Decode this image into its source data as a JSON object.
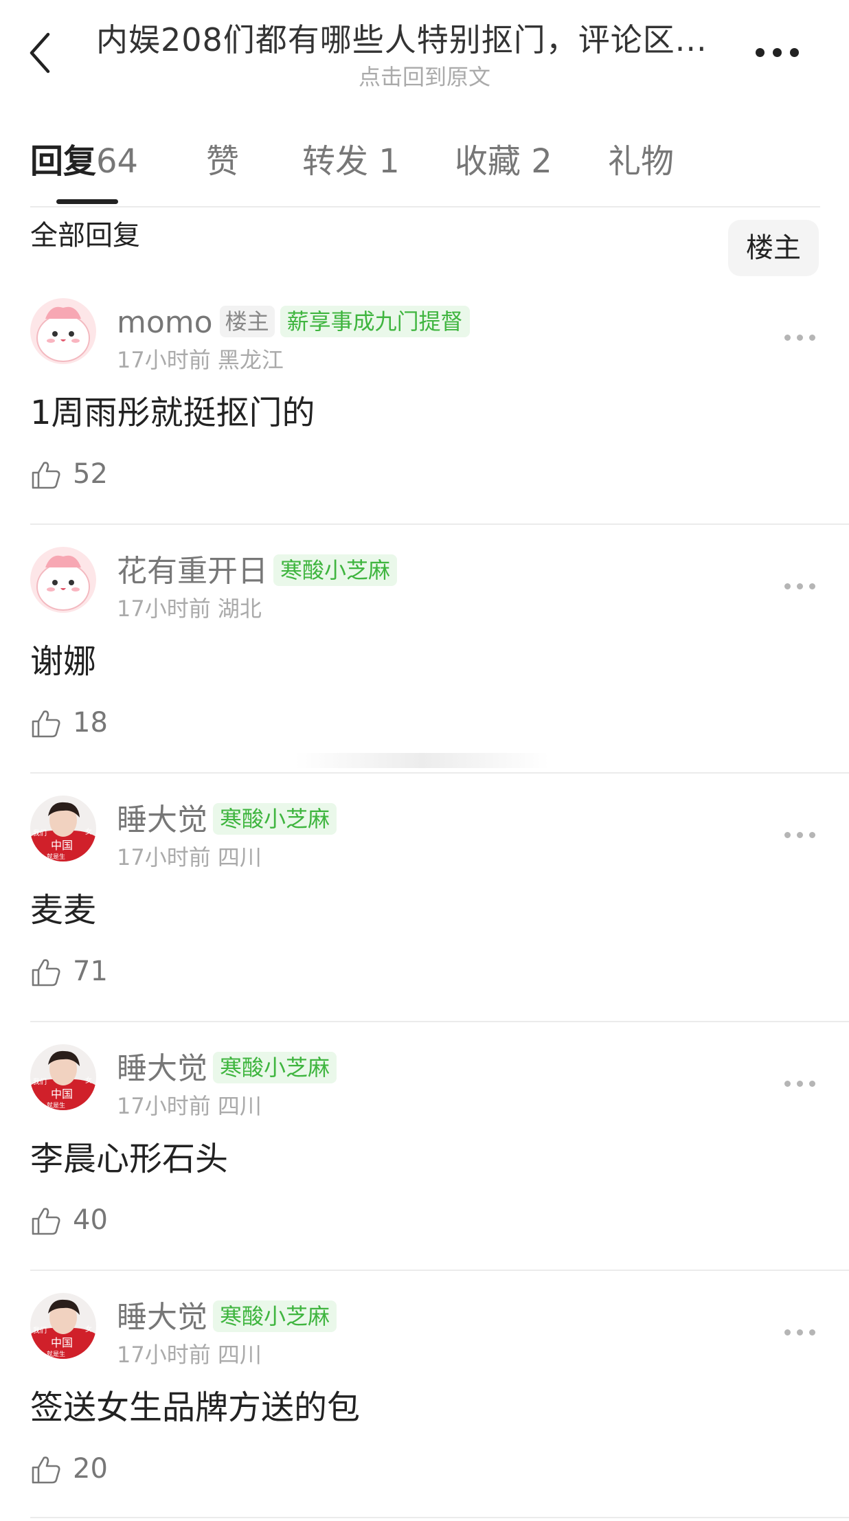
{
  "header": {
    "title": "内娱208们都有哪些人特别抠门，评论区...",
    "subtitle": "点击回到原文"
  },
  "tabs": [
    {
      "label": "回复",
      "count": "64"
    },
    {
      "label": "赞",
      "count": ""
    },
    {
      "label": "转发",
      "count": "1"
    },
    {
      "label": "收藏",
      "count": "2"
    },
    {
      "label": "礼物",
      "count": ""
    }
  ],
  "section": {
    "title": "全部回复",
    "owner_filter": "楼主"
  },
  "comments": [
    {
      "user": "momo",
      "owner_tag": "楼主",
      "level": "薪享事成九门提督",
      "time_location": "17小时前 黑龙江",
      "text": "1周雨彤就挺抠门的",
      "likes": "52",
      "avatar": "pink-blob-avatar"
    },
    {
      "user": "花有重开日",
      "owner_tag": "",
      "level": "寒酸小芝麻",
      "time_location": "17小时前 湖北",
      "text": "谢娜",
      "likes": "18",
      "avatar": "pink-blob-avatar"
    },
    {
      "user": "睡大觉",
      "owner_tag": "",
      "level": "寒酸小芝麻",
      "time_location": "17小时前 四川",
      "text": "麦麦",
      "likes": "71",
      "avatar": "red-jersey-avatar"
    },
    {
      "user": "睡大觉",
      "owner_tag": "",
      "level": "寒酸小芝麻",
      "time_location": "17小时前 四川",
      "text": "李晨心形石头",
      "likes": "40",
      "avatar": "red-jersey-avatar"
    },
    {
      "user": "睡大觉",
      "owner_tag": "",
      "level": "寒酸小芝麻",
      "time_location": "17小时前 四川",
      "text": "签送女生品牌方送的包",
      "likes": "20",
      "avatar": "red-jersey-avatar"
    }
  ],
  "avatar_text": {
    "a": "我们",
    "b": "中国",
    "c": "女",
    "d": "就是生"
  },
  "colors": {
    "level_green": "#3fb53f",
    "text_dark": "#222222",
    "text_gray": "#777777"
  }
}
